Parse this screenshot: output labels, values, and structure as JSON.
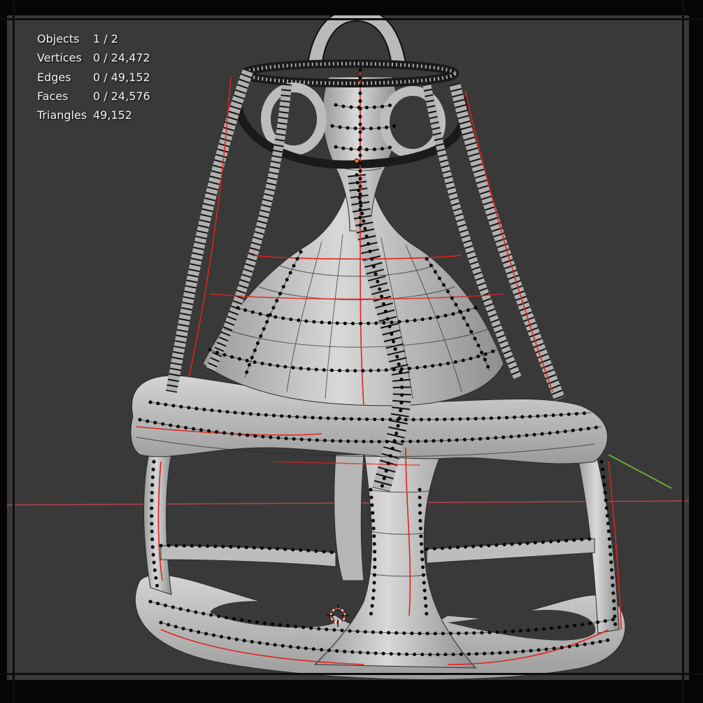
{
  "viewport": {
    "background": "#393939",
    "x_axis_color": "#b8444a",
    "y_axis_color": "#6aa83a",
    "mesh_fill": "#c9c9c9",
    "wire_color": "#2a2a2a",
    "seam_color": "#e0231e",
    "vertex_color": "#050505"
  },
  "stats": {
    "objects_label": "Objects",
    "objects_value": "1 / 2",
    "vertices_label": "Vertices",
    "vertices_value": "0 / 24,472",
    "edges_label": "Edges",
    "edges_value": "0 / 49,152",
    "faces_label": "Faces",
    "faces_value": "0 / 24,576",
    "triangles_label": "Triangles",
    "triangles_value": "49,152"
  },
  "icons": {
    "origin_marker": "object-origin-icon",
    "cursor": "3d-cursor-icon"
  }
}
